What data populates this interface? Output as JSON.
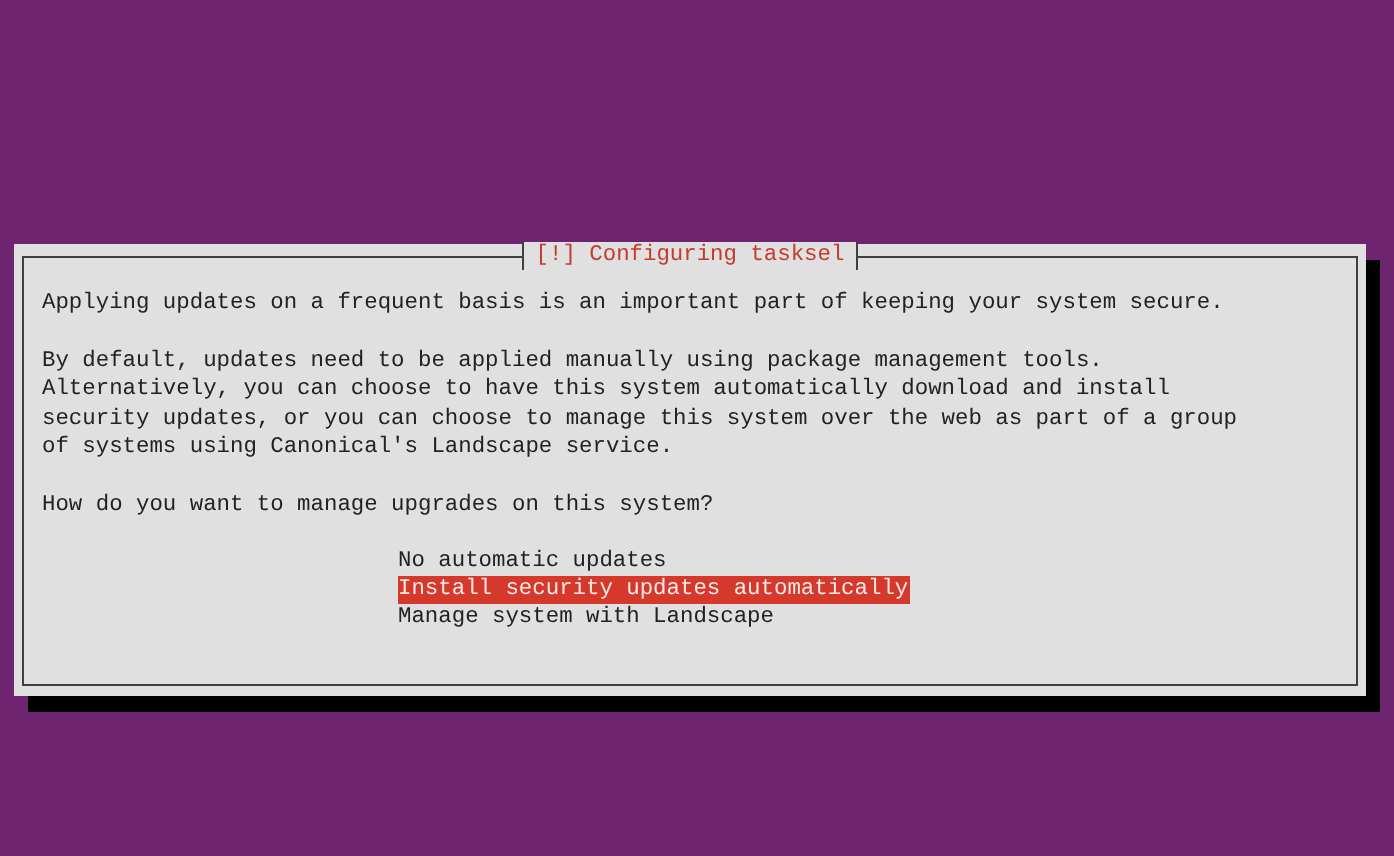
{
  "dialog": {
    "title": "[!] Configuring tasksel",
    "paragraphs": [
      "Applying updates on a frequent basis is an important part of keeping your system secure.",
      "By default, updates need to be applied manually using package management tools.\nAlternatively, you can choose to have this system automatically download and install\nsecurity updates, or you can choose to manage this system over the web as part of a group\nof systems using Canonical's Landscape service.",
      "How do you want to manage upgrades on this system?"
    ],
    "options": [
      {
        "label": "No automatic updates",
        "selected": false
      },
      {
        "label": "Install security updates automatically",
        "selected": true
      },
      {
        "label": "Manage system with Landscape",
        "selected": false
      }
    ]
  }
}
